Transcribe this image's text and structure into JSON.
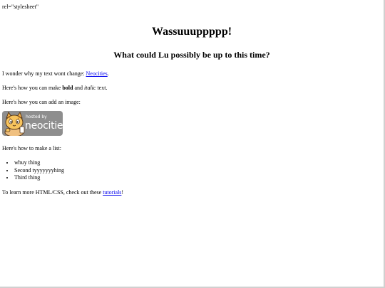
{
  "stray_text": "rel=\"stylesheet\"",
  "heading": "Wassuuuppppp!",
  "subheading": "What could Lu possibly be up to this time?",
  "p1": {
    "before": "I wonder why my text wont change: ",
    "link": "Neocities",
    "after": "."
  },
  "p2": {
    "before": "Here's how you can make ",
    "bold": "bold",
    "middle": " and ",
    "italic": "italic",
    "after": " text."
  },
  "p3": "Here's how you can add an image:",
  "badge": {
    "hosted": "hosted by",
    "brand": "neocities"
  },
  "p4": "Here's how to make a list:",
  "list": [
    "whuy thing",
    "Second tyyyyyyyhing",
    "Third thing"
  ],
  "p5": {
    "before": "To learn more HTML/CSS, check out these ",
    "link": "tutorials",
    "after": "!"
  }
}
